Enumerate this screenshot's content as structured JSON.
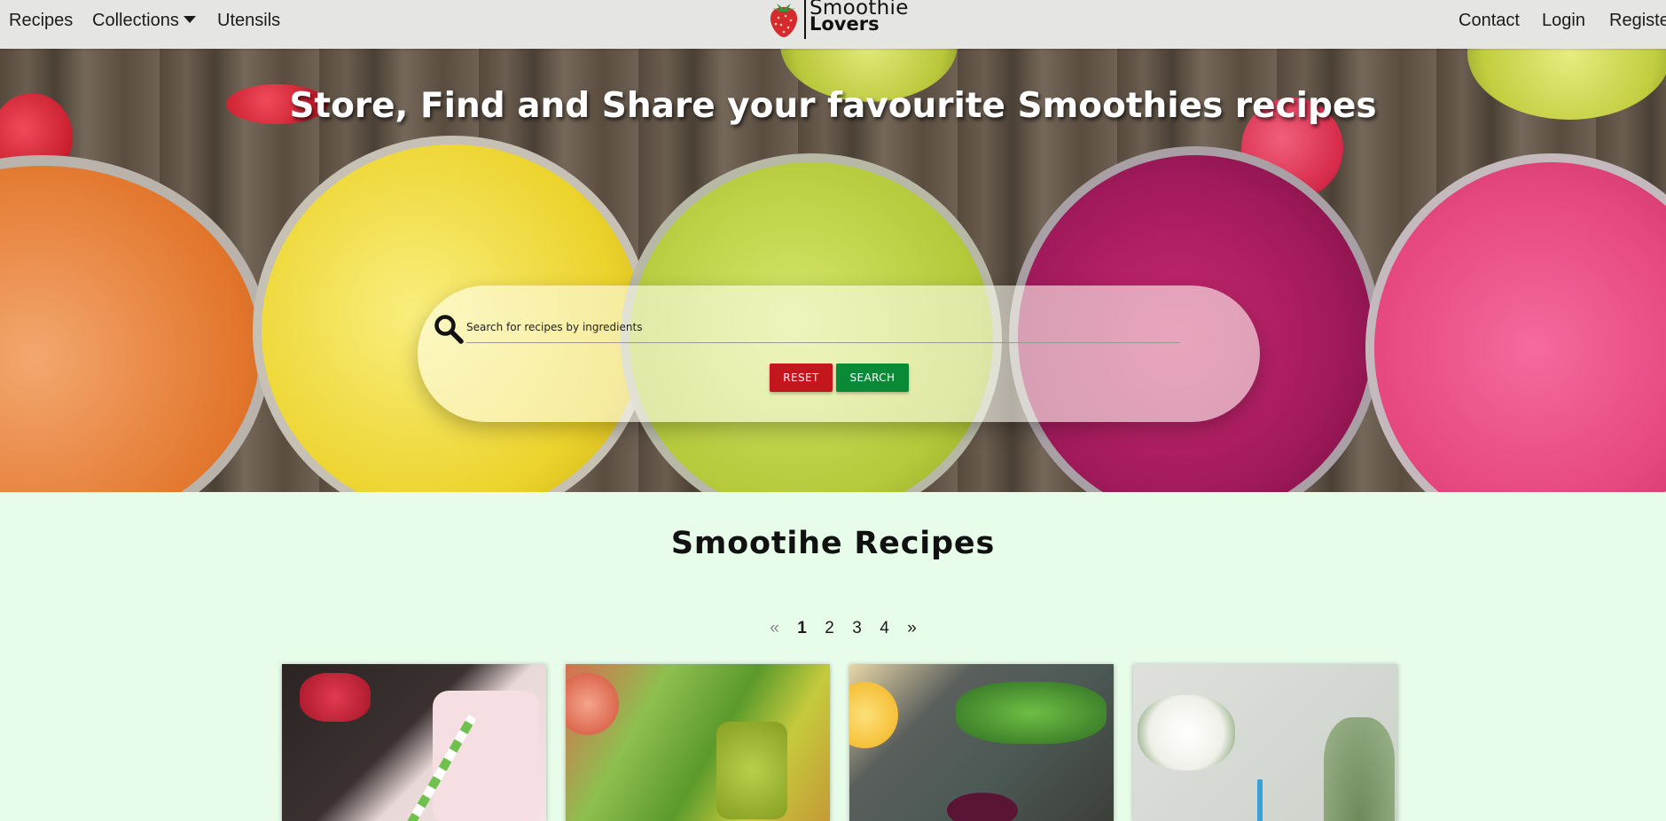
{
  "nav": {
    "left_items": [
      "Recipes",
      "Collections",
      "Utensils"
    ],
    "right_items": [
      "Contact",
      "Login",
      "Register"
    ]
  },
  "logo": {
    "line1": "Smoothie",
    "line2": "Lovers"
  },
  "hero": {
    "title": "Store, Find and Share your favourite Smoothies recipes",
    "search": {
      "placeholder": "Search for recipes by ingredients",
      "value": "",
      "reset_label": "RESET",
      "search_label": "SEARCH"
    }
  },
  "content": {
    "section_title": "Smootihe Recipes",
    "pagination": {
      "prev": "«",
      "pages": [
        "1",
        "2",
        "3",
        "4"
      ],
      "current": "1",
      "next": "»"
    },
    "cards": [
      {
        "image": "raspberry-smoothie-image"
      },
      {
        "image": "celery-green-smoothie-image"
      },
      {
        "image": "beetroot-smoothie-image"
      },
      {
        "image": "pineapple-smoothie-image"
      }
    ]
  },
  "colors": {
    "nav_bg": "#e5e6e3",
    "page_bg": "#e7fce9",
    "reset": "#c3171d",
    "search": "#0a8a37"
  }
}
